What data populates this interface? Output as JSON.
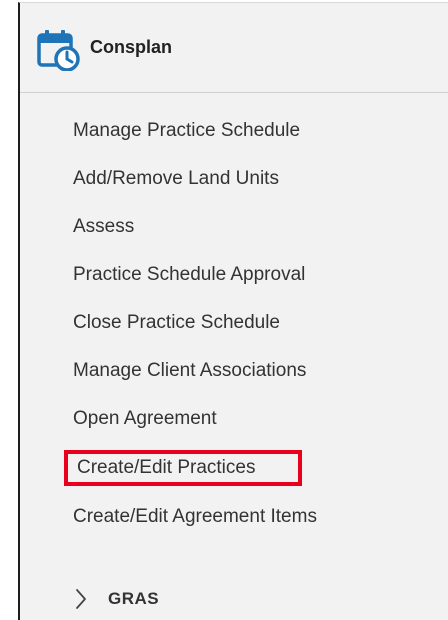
{
  "app": {
    "title": "Consplan",
    "icon": "calendar-clock-icon",
    "icon_color": "#1f73b7"
  },
  "menu": {
    "items": [
      {
        "label": "Manage Practice Schedule"
      },
      {
        "label": "Add/Remove Land Units"
      },
      {
        "label": "Assess"
      },
      {
        "label": "Practice Schedule Approval"
      },
      {
        "label": "Close Practice Schedule"
      },
      {
        "label": "Manage Client Associations"
      },
      {
        "label": "Open Agreement"
      },
      {
        "label": "Create/Edit Practices",
        "highlighted": true,
        "highlight_color": "#e8001c"
      },
      {
        "label": "Create/Edit Agreement Items"
      }
    ],
    "group": {
      "label": "GRAS",
      "icon": "chevron-right-icon",
      "expanded": false
    }
  }
}
